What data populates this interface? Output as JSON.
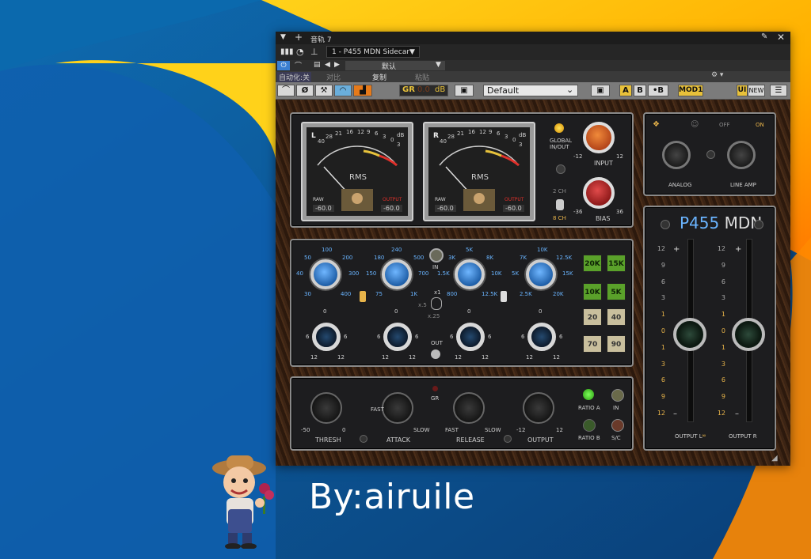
{
  "window": {
    "track_title": "音轨 7",
    "plugin_slot": "1 - P455 MDN Sidecar",
    "preset_bar_name": "默认",
    "menu": {
      "auto": "自动化:关",
      "compare": "对比",
      "copy": "复制",
      "paste": "粘贴"
    },
    "gr_label": "GR",
    "gr_value": "0.0",
    "gr_unit": "dB",
    "preset_name": "Default",
    "ab": {
      "a": "A",
      "b": "B",
      "copy": "•B"
    },
    "mod_label": "MOD1",
    "ui_label": "UI",
    "new_label": "NEW"
  },
  "meters": {
    "left": {
      "channel": "L",
      "mode": "RMS",
      "raw_label": "RAW",
      "output_label": "OUTPUT",
      "raw_value": "-60.0",
      "output_value": "-60.0",
      "unit": "dB"
    },
    "right": {
      "channel": "R",
      "mode": "RMS",
      "raw_label": "RAW",
      "output_label": "OUTPUT",
      "raw_value": "-60.0",
      "output_value": "-60.0",
      "unit": "dB"
    },
    "scale": [
      "40",
      "28",
      "21",
      "16",
      "12",
      "9",
      "6",
      "3",
      "0",
      "3"
    ]
  },
  "global": {
    "label1": "GLOBAL",
    "label2": "IN/OUT",
    "ch2": "2 CH",
    "ch8": "8 CH"
  },
  "input_knob": {
    "label": "INPUT",
    "min": "-12",
    "max": "12"
  },
  "bias_knob": {
    "label": "BIAS",
    "min": "-36",
    "max": "36"
  },
  "analog": {
    "off": "OFF",
    "on": "ON",
    "analog": "ANALOG",
    "line_amp": "LINE AMP"
  },
  "brand": {
    "model": "P455",
    "suffix": "MDN"
  },
  "eq": {
    "band1": [
      "50",
      "100",
      "200",
      "40",
      "300",
      "30",
      "400"
    ],
    "band2": [
      "180",
      "240",
      "500",
      "150",
      "700",
      "75",
      "1K"
    ],
    "band3": [
      "3K",
      "5K",
      "8K",
      "1.5K",
      "10K",
      "800",
      "12.5K"
    ],
    "band4": [
      "7K",
      "10K",
      "12.5K",
      "5K",
      "15K",
      "2.5K",
      "20K"
    ],
    "in_label": "IN",
    "x1": "x1",
    "x5": "x.5",
    "x25": "x.25",
    "out_label": "OUT",
    "gain_scale": [
      "0",
      "2",
      "4",
      "6",
      "9",
      "12"
    ]
  },
  "filters": {
    "col1": [
      "20K",
      "10K",
      "20",
      "70"
    ],
    "col2": [
      "15K",
      "5K",
      "40",
      "90"
    ]
  },
  "comp": {
    "thresh": "THRESH",
    "thresh_min": "-50",
    "thresh_max": "0",
    "attack": "ATTACK",
    "fast": "FAST",
    "slow": "SLOW",
    "release": "RELEASE",
    "output": "OUTPUT",
    "out_min": "-12",
    "out_max": "12",
    "gr": "GR",
    "ratio_a": "RATIO A",
    "ratio_b": "RATIO B",
    "in": "IN",
    "sc": "S/C"
  },
  "faders": {
    "scale_top": [
      "12",
      "9",
      "6",
      "3",
      "1",
      "0",
      "1",
      "3",
      "6",
      "9",
      "12"
    ],
    "plus": "+",
    "minus": "–",
    "output_l": "OUTPUT L",
    "output_r": "OUTPUT R"
  },
  "caption": "By:airuile"
}
